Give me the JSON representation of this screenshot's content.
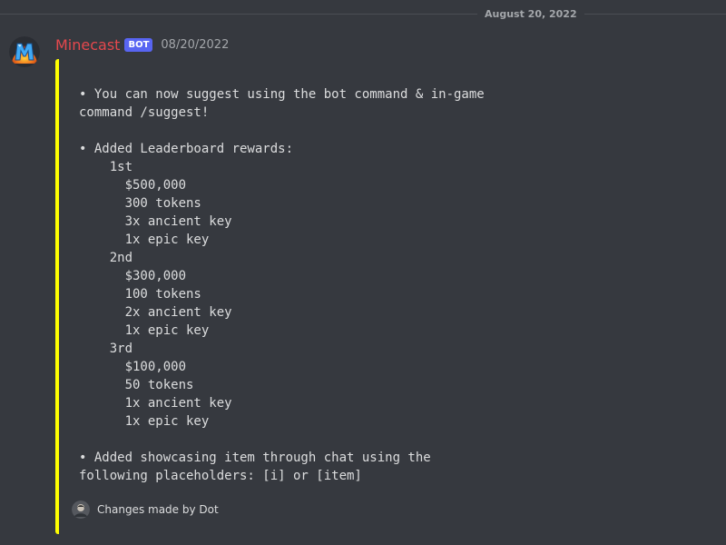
{
  "date_divider": "August 20, 2022",
  "message": {
    "username": "Minecast",
    "bot_tag": "BOT",
    "timestamp": "08/20/2022",
    "colors": {
      "username": "#e5484d",
      "bot_tag": "#5865f2",
      "embed_border": "#ffff00",
      "background": "#36393f"
    },
    "avatar_icon": "minecast-logo-icon",
    "embed": {
      "description_lines": [
        "• You can now suggest using the bot command & in-game",
        "command /suggest!",
        "",
        "• Added Leaderboard rewards:",
        "    1st",
        "      $500,000",
        "      300 tokens",
        "      3x ancient key",
        "      1x epic key",
        "    2nd",
        "      $300,000",
        "      100 tokens",
        "      2x ancient key",
        "      1x epic key",
        "    3rd",
        "      $100,000",
        "      50 tokens",
        "      1x ancient key",
        "      1x epic key",
        "",
        "• Added showcasing item through chat using the",
        "following placeholders: [i] or [item]"
      ],
      "footer": {
        "icon": "user-avatar-icon",
        "text": "Changes made by Dot"
      }
    }
  }
}
